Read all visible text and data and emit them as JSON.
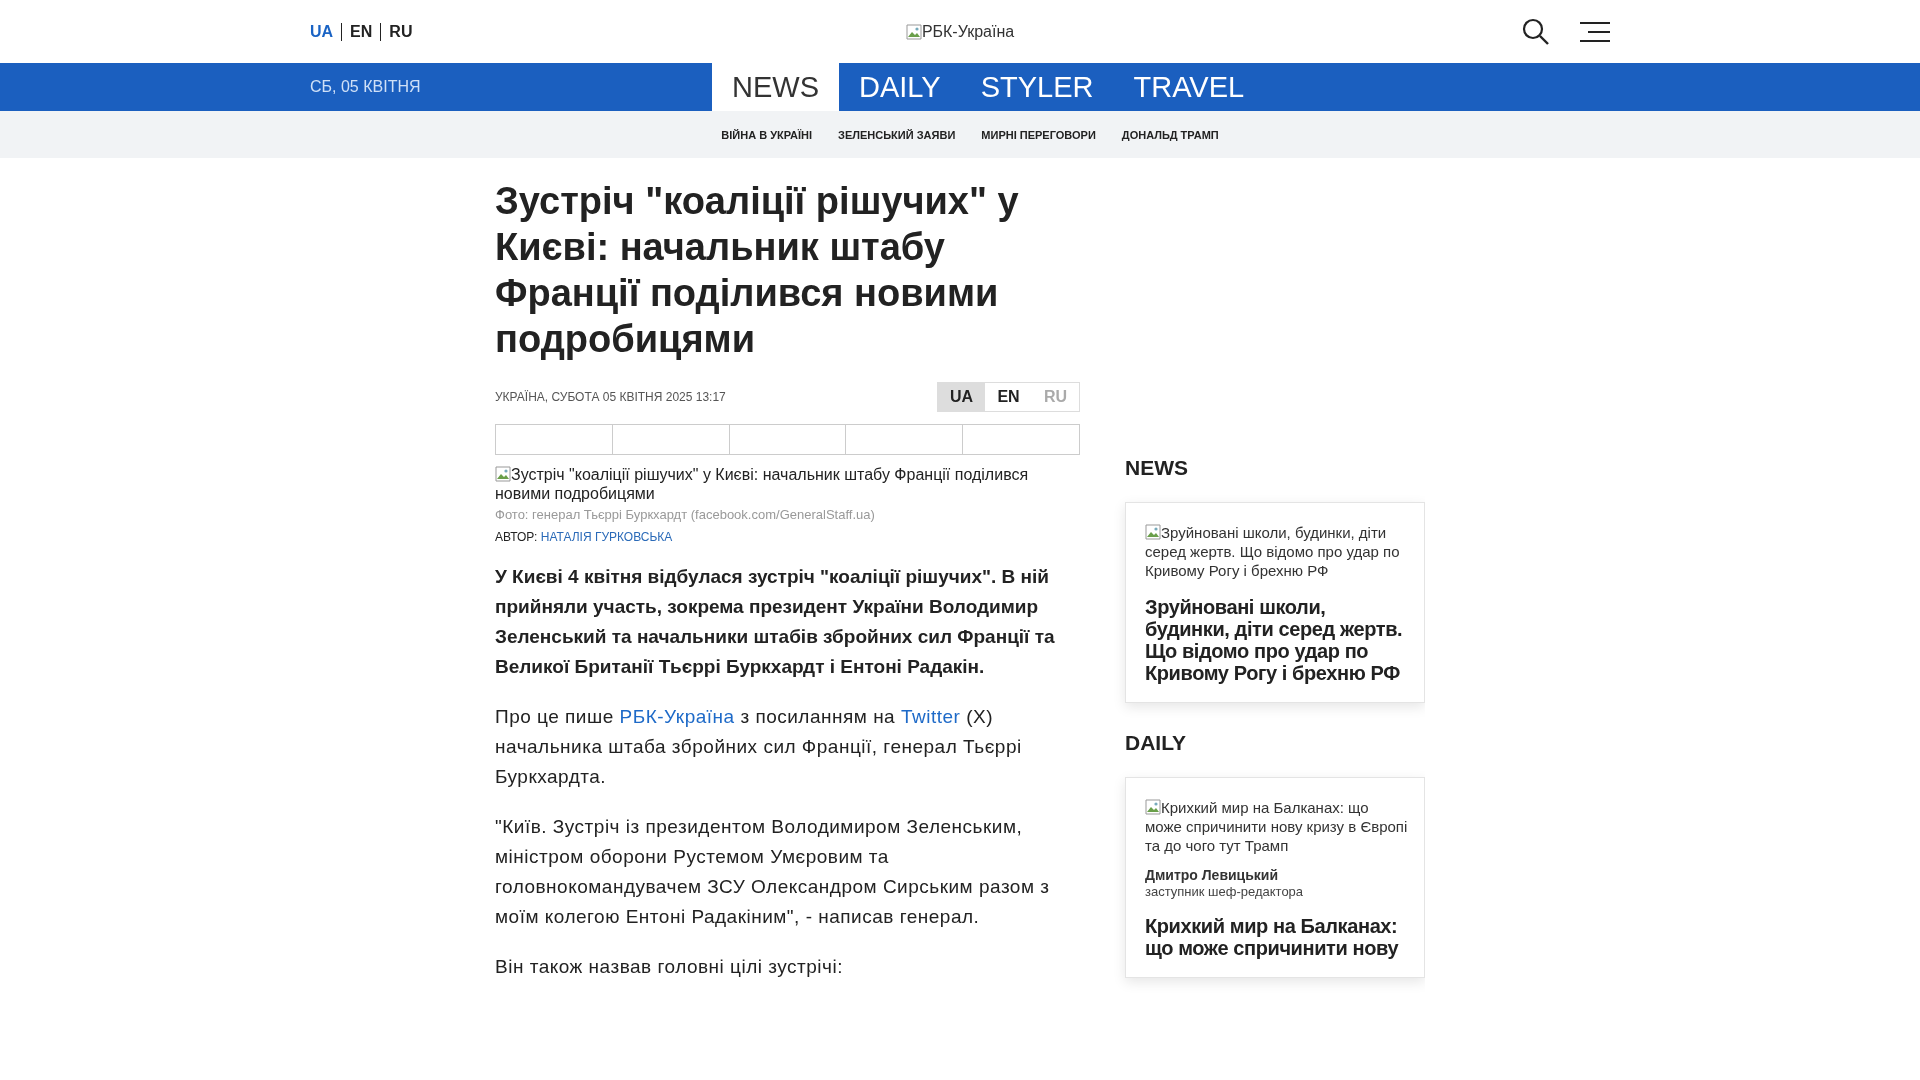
{
  "header": {
    "languages": [
      {
        "label": "UA",
        "selected": true
      },
      {
        "label": "EN",
        "selected": false
      },
      {
        "label": "RU",
        "selected": false
      }
    ],
    "logo_alt": "РБК-Україна"
  },
  "nav": {
    "date": "СБ, 05 КВІТНЯ",
    "tabs": [
      {
        "label": "NEWS",
        "selected": true
      },
      {
        "label": "DAILY",
        "selected": false
      },
      {
        "label": "STYLER",
        "selected": false
      },
      {
        "label": "TRAVEL",
        "selected": false
      }
    ],
    "topics": [
      "ВІЙНА В УКРАЇНІ",
      "ЗЕЛЕНСЬКИЙ ЗАЯВИ",
      "МИРНІ ПЕРЕГОВОРИ",
      "ДОНАЛЬД ТРАМП"
    ]
  },
  "article": {
    "title": "Зустріч \"коаліції рішучих\" у Києві: начальник штабу Франції поділився новими подробицями",
    "dateline": "УКРАЇНА, СУБОТА 05 КВІТНЯ 2025 13:17",
    "languages": [
      {
        "label": "UA",
        "selected": true,
        "disabled": false
      },
      {
        "label": "EN",
        "selected": false,
        "disabled": false
      },
      {
        "label": "RU",
        "selected": false,
        "disabled": true
      }
    ],
    "image_alt": "Зустріч \"коаліції рішучих\" у Києві: начальник штабу Франції поділився новими подробицями",
    "photo_caption": "Фото: генерал Тьєррі Буркхардт (facebook.com/GeneralStaff.ua)",
    "author_label": "АВТОР:",
    "author": "НАТАЛІЯ ГУРКОВСЬКА",
    "lead": "У Києві 4 квітня відбулася зустріч \"коаліції рішучих\". В ній прийняли участь, зокрема президент України Володимир Зеленський та начальники штабів збройних сил Франції та Великої Британії Тьєррі Буркхардт і Ентоні Радакін.",
    "source_paragraph": [
      {
        "kind": "text",
        "text": "Про це пише "
      },
      {
        "kind": "link",
        "text": "РБК-Україна"
      },
      {
        "kind": "text",
        "text": " з посиланням на "
      },
      {
        "kind": "link",
        "text": "Twitter"
      },
      {
        "kind": "text",
        "text": " (X) начальника штаба збройних сил Франції, генерал Тьєррі Буркхардта."
      }
    ],
    "paragraphs": [
      "\"Київ. Зустріч із президентом Володимиром Зеленським, міністром оборони Рустемом Умєровим та головнокомандувачем ЗСУ Олександром Сирським разом з моїм колегою Ентоні Радакіним\", - написав генерал.",
      "Він також назвав головні цілі зустрічі:"
    ]
  },
  "sidebar": [
    {
      "heading": "NEWS",
      "image_alt": "Зруйновані школи, будинки, діти серед жертв. Що відомо про удар по Кривому Рогу і брехню РФ",
      "title": "Зруйновані школи, будинки, діти серед жертв. Що відомо про удар по Кривому Рогу і брехню РФ"
    },
    {
      "heading": "DAILY",
      "image_alt": "Крихкий мир на Балканах: що може спричинити нову кризу в Європі та до чого тут Трамп",
      "author": "Дмитро Левицький",
      "author_role": "заступник шеф-редактора",
      "title": "Крихкий мир на Балканах: що може спричинити нову"
    }
  ]
}
